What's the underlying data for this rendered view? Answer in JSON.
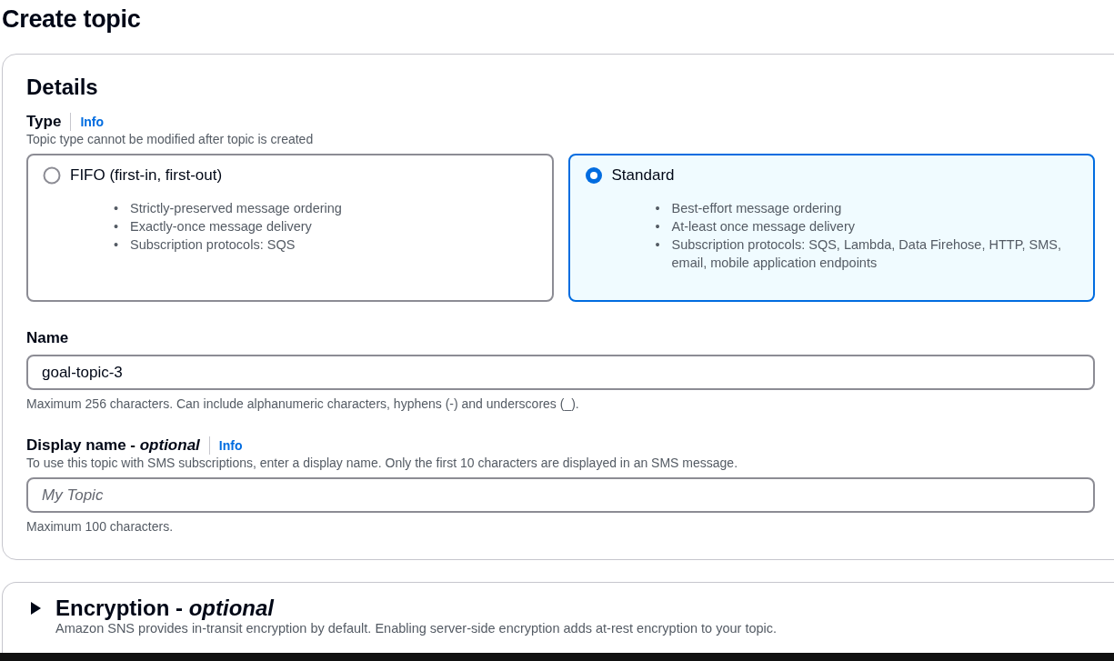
{
  "page": {
    "title": "Create topic"
  },
  "details": {
    "heading": "Details",
    "type_field": {
      "label": "Type",
      "info": "Info",
      "description": "Topic type cannot be modified after topic is created",
      "options": [
        {
          "label": "FIFO (first-in, first-out)",
          "selected": false,
          "features": [
            {
              "bullet": "•",
              "text": "Strictly-preserved message ordering"
            },
            {
              "bullet": "•",
              "text": "Exactly-once message delivery"
            },
            {
              "bullet": "•",
              "text": "Subscription protocols: SQS"
            }
          ]
        },
        {
          "label": "Standard",
          "selected": true,
          "features": [
            {
              "bullet": "•",
              "text": "Best-effort message ordering"
            },
            {
              "bullet": "•",
              "text": "At-least once message delivery"
            },
            {
              "bullet": "•",
              "text": "Subscription protocols: SQS, Lambda, Data Firehose, HTTP, SMS, email, mobile application endpoints"
            }
          ]
        }
      ]
    },
    "fields": [
      {
        "label": "Name",
        "value": "goal-topic-3",
        "constraint": "Maximum 256 characters. Can include alphanumeric characters, hyphens (-) and underscores (_)."
      },
      {
        "label": "Display name - *optional*",
        "info": "Info",
        "description": "To use this topic with SMS subscriptions, enter a display name. Only the first 10 characters are displayed in an SMS message.",
        "placeholder": "My Topic",
        "constraint": "Maximum 100 characters."
      }
    ]
  },
  "encryption": {
    "heading": "Encryption - *optional*",
    "expanded": false,
    "description": "Amazon SNS provides in-transit encryption by default. Enabling server-side encryption adds at-rest encryption to your topic."
  }
}
